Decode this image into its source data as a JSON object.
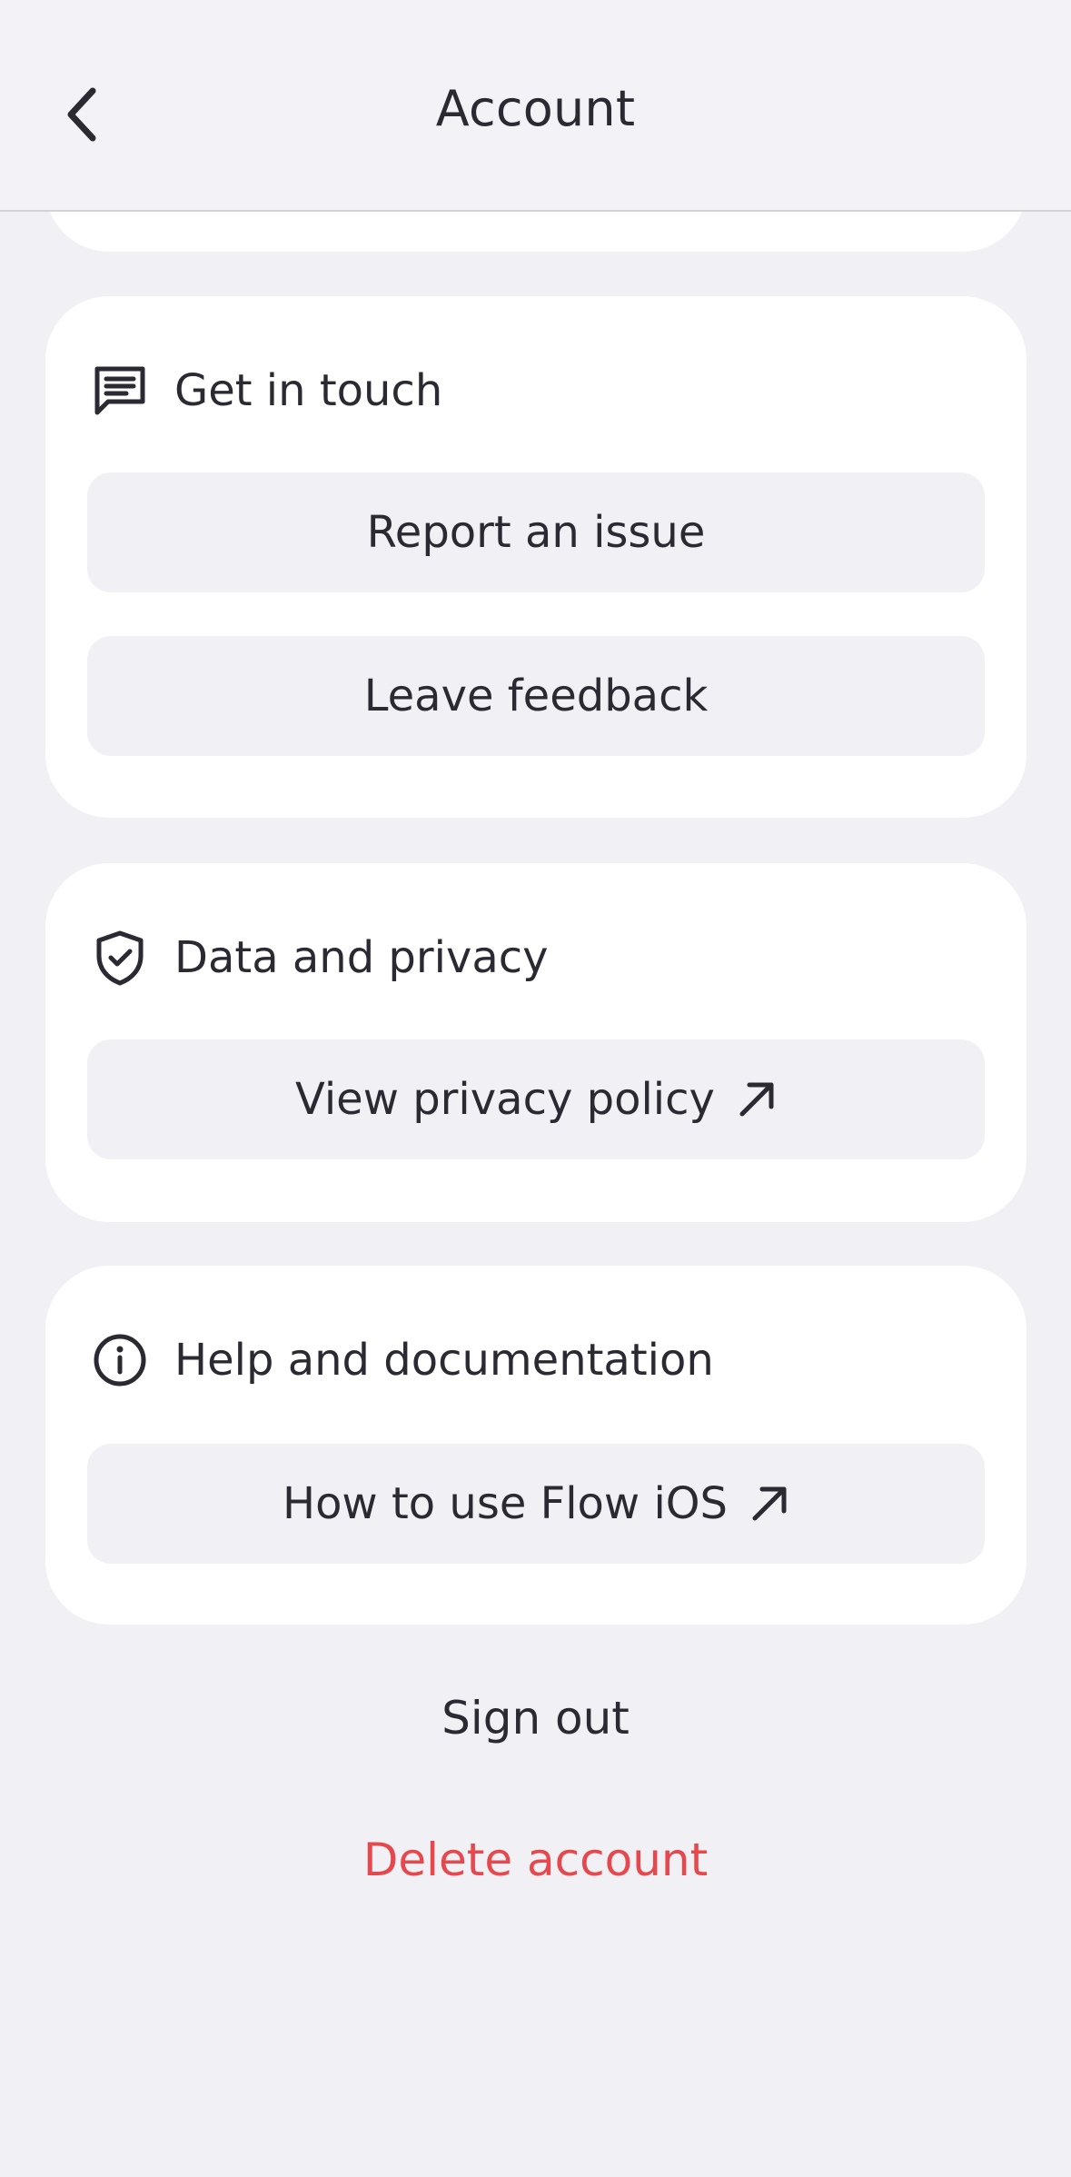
{
  "header": {
    "title": "Account",
    "back_icon": "chevron-left-icon"
  },
  "cards": {
    "get_in_touch": {
      "icon": "message-square-icon",
      "title": "Get in touch",
      "buttons": [
        "Report an issue",
        "Leave feedback"
      ]
    },
    "data_privacy": {
      "icon": "shield-check-icon",
      "title": "Data and privacy",
      "buttons": [
        "View privacy policy"
      ],
      "external_icon": "arrow-up-right-icon"
    },
    "help": {
      "icon": "info-circle-icon",
      "title": "Help and documentation",
      "buttons": [
        "How to use Flow iOS"
      ],
      "external_icon": "arrow-up-right-icon"
    }
  },
  "actions": {
    "sign_out": "Sign out",
    "delete_account": "Delete account"
  },
  "colors": {
    "background": "#F1F0F5",
    "card": "#FFFFFF",
    "button_fill": "#F1F0F4",
    "text": "#2B2A33",
    "danger": "#E5484D"
  }
}
